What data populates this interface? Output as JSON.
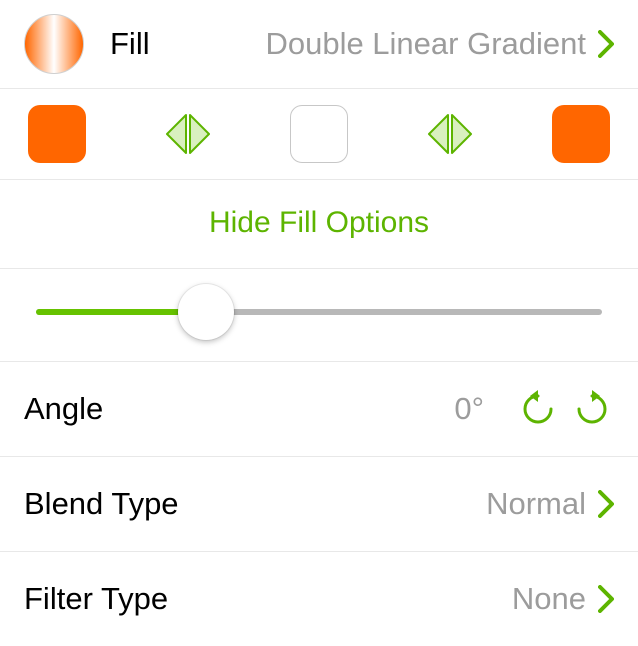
{
  "colors": {
    "accent": "#5db400",
    "swatch_orange": "#ff6600",
    "value_gray": "#9c9c9c"
  },
  "header": {
    "label": "Fill",
    "value": "Double Linear Gradient"
  },
  "swatches": {
    "left": "orange",
    "mid": "white",
    "right": "orange",
    "flip_left": "flip",
    "flip_right": "flip"
  },
  "hide_label": "Hide Fill Options",
  "slider": {
    "percent": 30
  },
  "angle": {
    "label": "Angle",
    "value": "0°"
  },
  "blend": {
    "label": "Blend Type",
    "value": "Normal"
  },
  "filter": {
    "label": "Filter Type",
    "value": "None"
  }
}
